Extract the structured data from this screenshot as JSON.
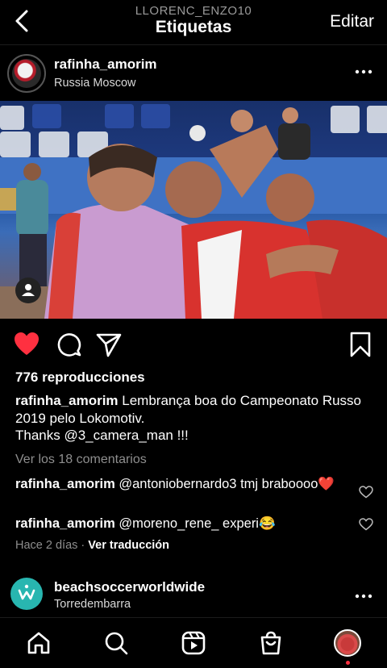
{
  "header": {
    "username": "LLORENC_ENZO10",
    "title": "Etiquetas",
    "edit_label": "Editar"
  },
  "post": {
    "username": "rafinha_amorim",
    "location": "Russia Moscow",
    "views": "776 reproducciones",
    "caption_user": "rafinha_amorim",
    "caption_text": " Lembrança boa do Campeonato Russo 2019 pelo Lokomotiv.",
    "caption_thanks": "Thanks @3_camera_man !!!",
    "view_comments": "Ver los 18 comentarios",
    "comments": [
      {
        "user": "rafinha_amorim",
        "text": " @antoniobernardo3 tmj braboooo❤️"
      },
      {
        "user": "rafinha_amorim",
        "text": " @moreno_rene_  experi😂"
      }
    ],
    "time_ago": "Hace 2 días",
    "separator": " · ",
    "translate": "Ver traducción",
    "liked": true,
    "like_color": "#ff3040"
  },
  "next_post": {
    "username": "beachsoccerworldwide",
    "location": "Torredembarra"
  },
  "icons": {
    "back": "chevron-left-icon",
    "more": "more-horizontal-icon",
    "like": "heart-icon",
    "comment": "comment-icon",
    "share": "send-icon",
    "save": "bookmark-icon",
    "tag": "person-tag-icon",
    "nav": [
      "home-icon",
      "search-icon",
      "reels-icon",
      "shop-icon",
      "profile-avatar"
    ]
  }
}
